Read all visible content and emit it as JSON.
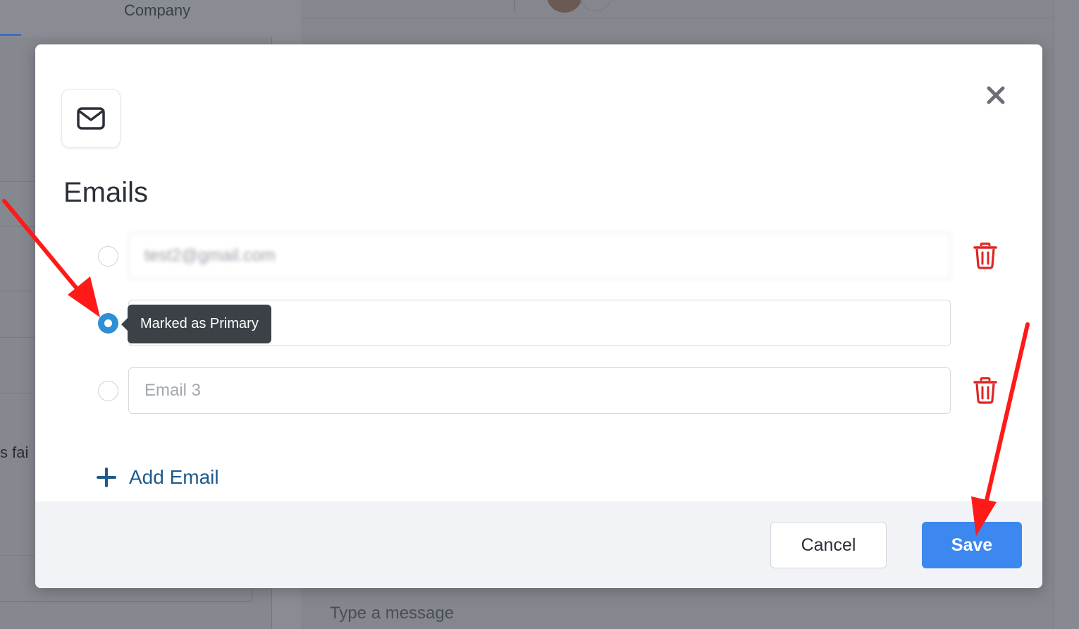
{
  "background": {
    "tab_label": "Company",
    "snippet_text": "s fai",
    "message_placeholder": "Type a message"
  },
  "modal": {
    "icon": "envelope-icon",
    "close_icon": "close-icon",
    "title": "Emails",
    "emails": [
      {
        "value": "test2@gmail.com",
        "placeholder": "",
        "primary": false,
        "deletable": true,
        "blurred": true
      },
      {
        "value": "",
        "placeholder": "",
        "primary": true,
        "deletable": false,
        "blurred": false
      },
      {
        "value": "",
        "placeholder": "Email 3",
        "primary": false,
        "deletable": true,
        "blurred": false
      }
    ],
    "tooltip": "Marked as Primary",
    "add_email_label": "Add Email",
    "cancel_label": "Cancel",
    "save_label": "Save"
  },
  "colors": {
    "primary_blue": "#3d87f0",
    "radio_selected": "#2e8fd6",
    "trash_red": "#e02424",
    "annotation_red": "#ff1a1a",
    "link_blue": "#1f5a8a"
  }
}
